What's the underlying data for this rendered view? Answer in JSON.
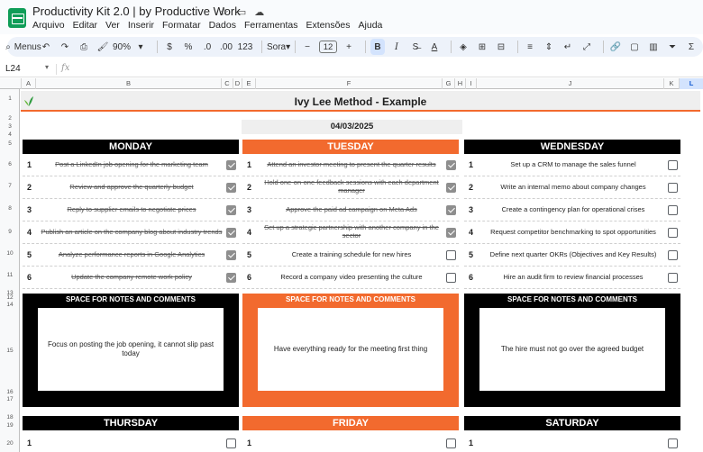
{
  "app": {
    "doc_title": "Productivity Kit 2.0 | by Productive Work",
    "menu": [
      "Arquivo",
      "Editar",
      "Ver",
      "Inserir",
      "Formatar",
      "Dados",
      "Ferramentas",
      "Extensões",
      "Ajuda"
    ]
  },
  "toolbar": {
    "menus_label": "Menus",
    "zoom": "90%",
    "currency": "$",
    "percent": "%",
    "dec_decrease": ".0",
    "dec_increase": ".00",
    "num_format": "123",
    "font": "Sora",
    "font_size": "12",
    "bold": "B",
    "italic": "I",
    "text_color": "A"
  },
  "formula_bar": {
    "cell_ref": "L24",
    "fx": "fx"
  },
  "columns": [
    "A",
    "B",
    "C",
    "D",
    "E",
    "F",
    "G",
    "H",
    "I",
    "J",
    "K",
    "L"
  ],
  "selected_column": "L",
  "rows": [
    "1",
    "2",
    "3",
    "4",
    "5",
    "6",
    "7",
    "8",
    "9",
    "10",
    "11",
    "12",
    "13",
    "14",
    "15",
    "16",
    "17",
    "18",
    "19",
    "20"
  ],
  "sheet": {
    "title": "Ivy Lee Method  - Example",
    "date": "04/03/2025",
    "accent": "#f26a2e",
    "dark": "#000000",
    "days": [
      {
        "name": "MONDAY",
        "color": "#000000",
        "tasks": [
          {
            "n": "1",
            "text": "Post a LinkedIn job opening for the marketing team",
            "done": true
          },
          {
            "n": "2",
            "text": "Review and approve the quarterly budget",
            "done": true
          },
          {
            "n": "3",
            "text": "Reply to supplier emails to negotiate prices",
            "done": true
          },
          {
            "n": "4",
            "text": "Publish an article on the company blog about industry trends",
            "done": true
          },
          {
            "n": "5",
            "text": "Analyze performance reports in Google Analytics",
            "done": true
          },
          {
            "n": "6",
            "text": "Update the company remote work policy",
            "done": true
          }
        ],
        "notes_title": "SPACE FOR NOTES AND COMMENTS",
        "notes": "Focus on posting the job opening, it cannot slip past today"
      },
      {
        "name": "TUESDAY",
        "color": "#f26a2e",
        "tasks": [
          {
            "n": "1",
            "text": "Attend an investor meeting to present the quarter results",
            "done": true
          },
          {
            "n": "2",
            "text": "Hold one-on-one feedback sessions with each department manager",
            "done": true
          },
          {
            "n": "3",
            "text": "Approve the paid ad campaign on Meta Ads",
            "done": true
          },
          {
            "n": "4",
            "text": "Set up a strategic partnership with another company in the sector",
            "done": true
          },
          {
            "n": "5",
            "text": "Create a training schedule for new hires",
            "done": false
          },
          {
            "n": "6",
            "text": "Record a company video presenting the culture",
            "done": false
          }
        ],
        "notes_title": "SPACE FOR NOTES AND COMMENTS",
        "notes": "Have everything ready for the meeting first thing"
      },
      {
        "name": "WEDNESDAY",
        "color": "#000000",
        "tasks": [
          {
            "n": "1",
            "text": "Set up a CRM to manage the sales funnel",
            "done": false
          },
          {
            "n": "2",
            "text": "Write an internal memo about company changes",
            "done": false
          },
          {
            "n": "3",
            "text": "Create a contingency plan for operational crises",
            "done": false
          },
          {
            "n": "4",
            "text": "Request competitor benchmarking to spot opportunities",
            "done": false
          },
          {
            "n": "5",
            "text": "Define next quarter OKRs (Objectives and Key Results)",
            "done": false
          },
          {
            "n": "6",
            "text": "Hire an audit firm to review financial processes",
            "done": false
          }
        ],
        "notes_title": "SPACE FOR NOTES AND COMMENTS",
        "notes": "The hire must not go over the agreed budget"
      }
    ],
    "next_days": [
      {
        "name": "THURSDAY",
        "color": "#000000",
        "first_num": "1"
      },
      {
        "name": "FRIDAY",
        "color": "#f26a2e",
        "first_num": "1"
      },
      {
        "name": "SATURDAY",
        "color": "#000000",
        "first_num": "1"
      }
    ]
  }
}
